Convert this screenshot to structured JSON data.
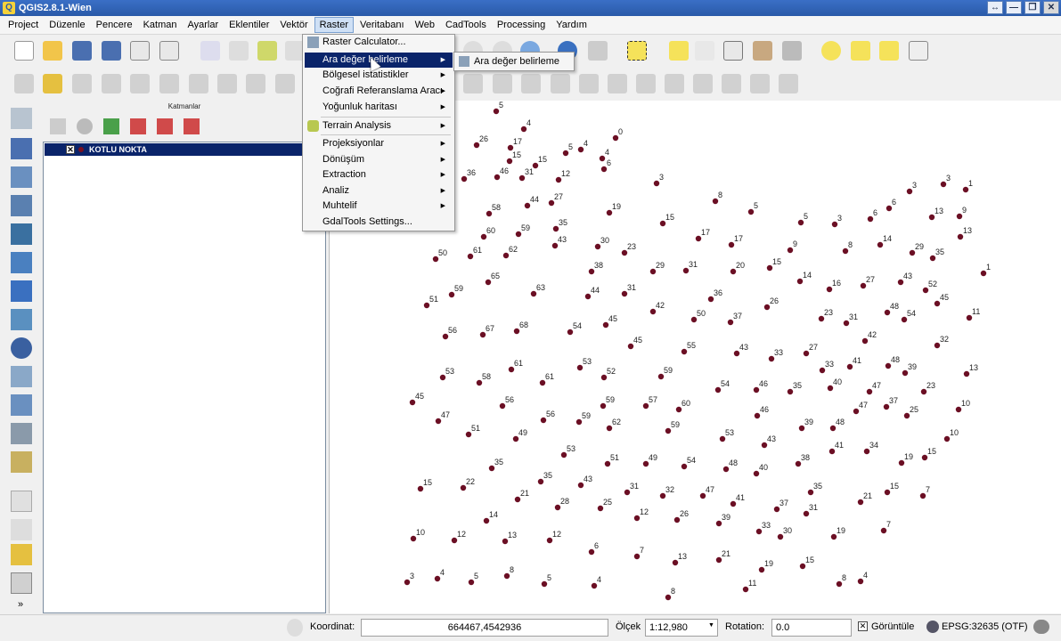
{
  "window": {
    "title": "QGIS2.8.1-Wien",
    "buttons": [
      "↔",
      "—",
      "❐",
      "✕"
    ]
  },
  "menubar": {
    "items": [
      "Project",
      "Düzenle",
      "Pencere",
      "Katman",
      "Ayarlar",
      "Eklentiler",
      "Vektör",
      "Raster",
      "Veritabanı",
      "Web",
      "CadTools",
      "Processing",
      "Yardım"
    ],
    "active": "Raster"
  },
  "raster_menu": {
    "items": [
      {
        "label": "Raster Calculator...",
        "icon": "calculator-icon"
      },
      {
        "label": "Ara değer belirleme",
        "submenu": true,
        "highlighted": true
      },
      {
        "label": "Bölgesel istatistikler",
        "submenu": true
      },
      {
        "label": "Coğrafi Referanslama Aracı",
        "submenu": true
      },
      {
        "label": "Yoğunluk haritası",
        "submenu": true
      },
      {
        "label": "Terrain Analysis",
        "submenu": true,
        "icon": "terrain-icon"
      },
      {
        "label": "Projeksiyonlar",
        "submenu": true
      },
      {
        "label": "Dönüşüm",
        "submenu": true
      },
      {
        "label": "Extraction",
        "submenu": true
      },
      {
        "label": "Analiz",
        "submenu": true
      },
      {
        "label": "Muhtelif",
        "submenu": true
      },
      {
        "label": "GdalTools Settings...",
        "submenu": false
      }
    ],
    "submenu_label": "Ara değer belirleme"
  },
  "layers_panel": {
    "title": "Katmanlar",
    "layers": [
      {
        "name": "KOTLU NOKTA",
        "checked": true,
        "check_mark": "✕"
      }
    ]
  },
  "statusbar": {
    "coord_label": "Koordinat:",
    "coord_value": "664467,4542936",
    "scale_label": "Ölçek",
    "scale_value": "1:12,980",
    "rotation_label": "Rotation:",
    "rotation_value": "0.0",
    "render_label": "Görüntüle",
    "render_checked": true,
    "render_check_mark": "✕",
    "crs": "EPSG:32635 (OTF)"
  },
  "colors": {
    "point": "#6b0f24",
    "highlight": "#0a246a",
    "titlebar": "#2a5aa8"
  },
  "map_points": [
    [
      "5",
      556,
      125
    ],
    [
      "4",
      587,
      145
    ],
    [
      "0",
      690,
      155
    ],
    [
      "26",
      534,
      163
    ],
    [
      "17",
      572,
      166
    ],
    [
      "15",
      571,
      181
    ],
    [
      "5",
      634,
      172
    ],
    [
      "4",
      651,
      168
    ],
    [
      "4",
      675,
      178
    ],
    [
      "36",
      520,
      201
    ],
    [
      "46",
      557,
      199
    ],
    [
      "31",
      585,
      200
    ],
    [
      "15",
      600,
      186
    ],
    [
      "12",
      626,
      202
    ],
    [
      "6",
      677,
      190
    ],
    [
      "3",
      736,
      206
    ],
    [
      "3",
      1020,
      215
    ],
    [
      "3",
      1058,
      207
    ],
    [
      "1",
      1083,
      213
    ],
    [
      "44",
      591,
      231
    ],
    [
      "27",
      618,
      228
    ],
    [
      "8",
      802,
      226
    ],
    [
      "5",
      842,
      238
    ],
    [
      "58",
      548,
      240
    ],
    [
      "19",
      683,
      239
    ],
    [
      "35",
      623,
      257
    ],
    [
      "15",
      743,
      251
    ],
    [
      "5",
      898,
      250
    ],
    [
      "3",
      936,
      252
    ],
    [
      "6",
      976,
      246
    ],
    [
      "6",
      997,
      234
    ],
    [
      "13",
      1045,
      244
    ],
    [
      "9",
      1076,
      243
    ],
    [
      "60",
      542,
      266
    ],
    [
      "59",
      581,
      263
    ],
    [
      "43",
      622,
      276
    ],
    [
      "17",
      783,
      268
    ],
    [
      "17",
      820,
      275
    ],
    [
      "9",
      886,
      281
    ],
    [
      "8",
      948,
      282
    ],
    [
      "14",
      987,
      275
    ],
    [
      "29",
      1023,
      284
    ],
    [
      "35",
      1046,
      290
    ],
    [
      "13",
      1077,
      266
    ],
    [
      "50",
      488,
      291
    ],
    [
      "61",
      527,
      288
    ],
    [
      "62",
      567,
      287
    ],
    [
      "30",
      670,
      277
    ],
    [
      "23",
      700,
      284
    ],
    [
      "38",
      663,
      305
    ],
    [
      "29",
      732,
      305
    ],
    [
      "31",
      769,
      304
    ],
    [
      "20",
      822,
      305
    ],
    [
      "15",
      863,
      301
    ],
    [
      "14",
      897,
      316
    ],
    [
      "16",
      930,
      325
    ],
    [
      "27",
      968,
      321
    ],
    [
      "43",
      1010,
      317
    ],
    [
      "52",
      1038,
      326
    ],
    [
      "45",
      1051,
      341
    ],
    [
      "1",
      1103,
      307
    ],
    [
      "51",
      478,
      343
    ],
    [
      "59",
      506,
      331
    ],
    [
      "65",
      547,
      317
    ],
    [
      "63",
      598,
      330
    ],
    [
      "44",
      659,
      333
    ],
    [
      "31",
      700,
      330
    ],
    [
      "42",
      732,
      350
    ],
    [
      "36",
      797,
      336
    ],
    [
      "26",
      860,
      345
    ],
    [
      "23",
      921,
      358
    ],
    [
      "31",
      949,
      363
    ],
    [
      "48",
      995,
      351
    ],
    [
      "54",
      1014,
      359
    ],
    [
      "11",
      1087,
      357
    ],
    [
      "50",
      778,
      359
    ],
    [
      "37",
      819,
      362
    ],
    [
      "56",
      499,
      378
    ],
    [
      "67",
      541,
      376
    ],
    [
      "68",
      579,
      372
    ],
    [
      "54",
      639,
      373
    ],
    [
      "45",
      679,
      365
    ],
    [
      "45",
      707,
      389
    ],
    [
      "55",
      767,
      395
    ],
    [
      "43",
      826,
      397
    ],
    [
      "33",
      865,
      403
    ],
    [
      "27",
      904,
      397
    ],
    [
      "42",
      970,
      383
    ],
    [
      "32",
      1051,
      388
    ],
    [
      "33",
      922,
      416
    ],
    [
      "41",
      953,
      412
    ],
    [
      "48",
      996,
      411
    ],
    [
      "39",
      1015,
      419
    ],
    [
      "53",
      496,
      424
    ],
    [
      "58",
      537,
      430
    ],
    [
      "61",
      573,
      415
    ],
    [
      "61",
      608,
      430
    ],
    [
      "53",
      650,
      413
    ],
    [
      "52",
      677,
      424
    ],
    [
      "59",
      741,
      423
    ],
    [
      "54",
      805,
      438
    ],
    [
      "46",
      848,
      438
    ],
    [
      "35",
      886,
      440
    ],
    [
      "40",
      931,
      436
    ],
    [
      "47",
      975,
      440
    ],
    [
      "23",
      1036,
      440
    ],
    [
      "13",
      1084,
      420
    ],
    [
      "45",
      462,
      452
    ],
    [
      "56",
      563,
      456
    ],
    [
      "59",
      676,
      456
    ],
    [
      "57",
      724,
      456
    ],
    [
      "60",
      761,
      460
    ],
    [
      "46",
      849,
      467
    ],
    [
      "37",
      994,
      457
    ],
    [
      "47",
      960,
      462
    ],
    [
      "25",
      1017,
      467
    ],
    [
      "10",
      1075,
      460
    ],
    [
      "47",
      491,
      473
    ],
    [
      "51",
      525,
      488
    ],
    [
      "49",
      578,
      493
    ],
    [
      "56",
      609,
      472
    ],
    [
      "59",
      649,
      474
    ],
    [
      "62",
      683,
      481
    ],
    [
      "59",
      749,
      484
    ],
    [
      "53",
      810,
      493
    ],
    [
      "43",
      857,
      500
    ],
    [
      "39",
      899,
      481
    ],
    [
      "48",
      934,
      481
    ],
    [
      "41",
      933,
      507
    ],
    [
      "34",
      972,
      507
    ],
    [
      "10",
      1062,
      493
    ],
    [
      "53",
      632,
      511
    ],
    [
      "51",
      681,
      521
    ],
    [
      "49",
      724,
      521
    ],
    [
      "54",
      767,
      524
    ],
    [
      "48",
      814,
      527
    ],
    [
      "40",
      848,
      532
    ],
    [
      "38",
      895,
      521
    ],
    [
      "19",
      1011,
      520
    ],
    [
      "15",
      1037,
      514
    ],
    [
      "35",
      551,
      526
    ],
    [
      "15",
      471,
      549
    ],
    [
      "22",
      519,
      548
    ],
    [
      "21",
      580,
      561
    ],
    [
      "35",
      606,
      541
    ],
    [
      "43",
      651,
      545
    ],
    [
      "31",
      703,
      553
    ],
    [
      "32",
      743,
      557
    ],
    [
      "47",
      788,
      557
    ],
    [
      "41",
      822,
      566
    ],
    [
      "37",
      871,
      572
    ],
    [
      "35",
      909,
      553
    ],
    [
      "31",
      904,
      577
    ],
    [
      "21",
      965,
      564
    ],
    [
      "15",
      995,
      553
    ],
    [
      "7",
      1035,
      557
    ],
    [
      "28",
      625,
      570
    ],
    [
      "25",
      673,
      571
    ],
    [
      "12",
      714,
      582
    ],
    [
      "26",
      759,
      584
    ],
    [
      "39",
      806,
      588
    ],
    [
      "33",
      851,
      597
    ],
    [
      "30",
      875,
      603
    ],
    [
      "19",
      935,
      603
    ],
    [
      "7",
      991,
      596
    ],
    [
      "14",
      545,
      585
    ],
    [
      "10",
      463,
      605
    ],
    [
      "12",
      509,
      607
    ],
    [
      "13",
      566,
      608
    ],
    [
      "12",
      616,
      607
    ],
    [
      "6",
      663,
      620
    ],
    [
      "7",
      714,
      625
    ],
    [
      "13",
      757,
      632
    ],
    [
      "21",
      806,
      629
    ],
    [
      "19",
      854,
      640
    ],
    [
      "15",
      900,
      636
    ],
    [
      "3",
      456,
      654
    ],
    [
      "4",
      490,
      650
    ],
    [
      "5",
      528,
      654
    ],
    [
      "8",
      568,
      647
    ],
    [
      "5",
      610,
      656
    ],
    [
      "4",
      666,
      658
    ],
    [
      "8",
      749,
      671
    ],
    [
      "11",
      836,
      662
    ],
    [
      "8",
      941,
      656
    ],
    [
      "4",
      965,
      653
    ]
  ]
}
